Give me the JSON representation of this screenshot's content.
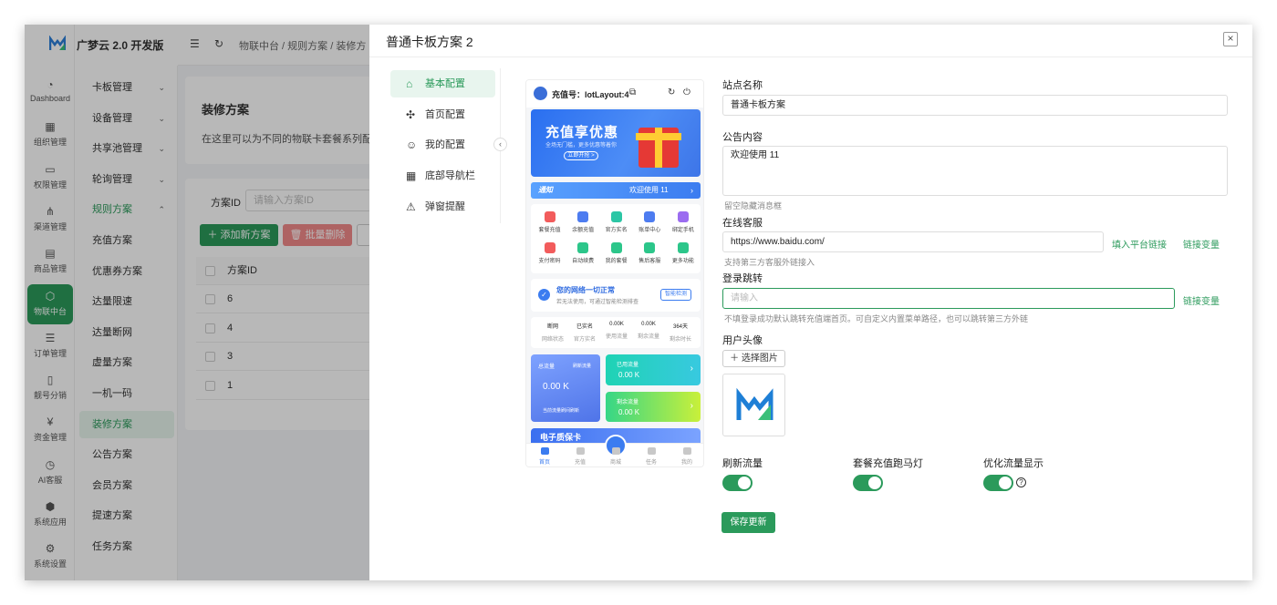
{
  "app": {
    "brand": "广梦云 2.0 开发版",
    "rail": [
      {
        "label": "Dashboard",
        "icon": "dashboard-icon"
      },
      {
        "label": "组织管理",
        "icon": "org-icon"
      },
      {
        "label": "权限管理",
        "icon": "permission-icon"
      },
      {
        "label": "渠道管理",
        "icon": "channel-icon"
      },
      {
        "label": "商品管理",
        "icon": "goods-icon"
      },
      {
        "label": "物联中台",
        "icon": "iot-icon",
        "active": true
      },
      {
        "label": "订单管理",
        "icon": "order-icon"
      },
      {
        "label": "靓号分销",
        "icon": "number-icon"
      },
      {
        "label": "资金管理",
        "icon": "fund-icon"
      },
      {
        "label": "AI客服",
        "icon": "ai-service-icon"
      },
      {
        "label": "系统应用",
        "icon": "system-app-icon"
      },
      {
        "label": "系统设置",
        "icon": "settings-icon"
      }
    ],
    "submenu": [
      {
        "label": "卡板管理",
        "chevron": "⌄"
      },
      {
        "label": "设备管理",
        "chevron": "⌄"
      },
      {
        "label": "共享池管理",
        "chevron": "⌄"
      },
      {
        "label": "轮询管理",
        "chevron": "⌄"
      },
      {
        "label": "规则方案",
        "chevron": "⌃",
        "open": true
      },
      {
        "label": "充值方案"
      },
      {
        "label": "优惠券方案"
      },
      {
        "label": "达量限速"
      },
      {
        "label": "达量断网"
      },
      {
        "label": "虚量方案"
      },
      {
        "label": "一机一码"
      },
      {
        "label": "装修方案",
        "active": true
      },
      {
        "label": "公告方案"
      },
      {
        "label": "会员方案"
      },
      {
        "label": "提速方案"
      },
      {
        "label": "任务方案"
      }
    ],
    "breadcrumb": "物联中台  /  规则方案  /  装修方",
    "page": {
      "title": "装修方案",
      "desc": "在这里可以为不同的物联卡套餐系列配置充",
      "filter_label": "方案ID",
      "filter_placeholder": "请输入方案ID",
      "add_btn": "＋ 添加新方案",
      "batch_delete_btn": "🗑 批量删除",
      "col_id": "方案ID",
      "rows": [
        "6",
        "4",
        "3",
        "1"
      ]
    }
  },
  "modal": {
    "title": "普通卡板方案 2",
    "tabs": [
      {
        "label": "基本配置",
        "icon": "home-icon",
        "glyph": "⌂",
        "active": true
      },
      {
        "label": "首页配置",
        "icon": "puzzle-icon",
        "glyph": "✣"
      },
      {
        "label": "我的配置",
        "icon": "user-icon",
        "glyph": "☺"
      },
      {
        "label": "底部导航栏",
        "icon": "grid-icon",
        "glyph": "▦"
      },
      {
        "label": "弹窗提醒",
        "icon": "alarm-icon",
        "glyph": "⚠"
      }
    ],
    "phone": {
      "header": "充值号：lotLayout:4",
      "banner_title": "充值享优惠",
      "banner_sub": "全场无门槛，更多优惠等着你",
      "banner_btn": "立即开抢 >",
      "notice_label": "通知",
      "notice_text": "欢迎使用 11",
      "services": [
        {
          "label": "套餐充值",
          "color": "#f25c5c"
        },
        {
          "label": "余额充值",
          "color": "#4d7cf0"
        },
        {
          "label": "官方实名",
          "color": "#2cc6a5"
        },
        {
          "label": "账单中心",
          "color": "#4d7cf0"
        },
        {
          "label": "绑定手机",
          "color": "#9b6cf0"
        },
        {
          "label": "支付密码",
          "color": "#f25c5c"
        },
        {
          "label": "自动续费",
          "color": "#2cc68a"
        },
        {
          "label": "我的套餐",
          "color": "#2cc68a"
        },
        {
          "label": "售后客服",
          "color": "#2cc68a"
        },
        {
          "label": "更多功能",
          "color": "#2cc68a"
        }
      ],
      "net_title": "您的网络一切正常",
      "net_sub": "若无法使用，可通过智能检测排查",
      "net_btn": "智能检测",
      "stats": [
        {
          "value": "断网",
          "label": "网络状态"
        },
        {
          "value": "已实名",
          "label": "官方实名"
        },
        {
          "value": "0.00K",
          "label": "使用流量"
        },
        {
          "value": "0.00K",
          "label": "剩余流量"
        },
        {
          "value": "364天",
          "label": "剩余时长"
        }
      ],
      "total_label": "总流量",
      "total_refresh": "刷新流量",
      "total_value": "0.00 K",
      "total_hint": "当前流量刷间刷新",
      "used_label": "已用流量",
      "used_value": "0.00 K",
      "left_label": "剩余流量",
      "left_value": "0.00 K",
      "ecard": "电子质保卡",
      "nav": [
        "首页",
        "充值",
        "商城",
        "任务",
        "我的"
      ]
    },
    "form": {
      "site_name_label": "站点名称",
      "site_name_value": "普通卡板方案",
      "notice_label": "公告内容",
      "notice_value": "欢迎使用 11",
      "notice_hint": "留空隐藏消息框",
      "service_label": "在线客服",
      "service_value": "https://www.baidu.com/",
      "service_link1": "填入平台链接",
      "service_link2": "链接变量",
      "service_hint": "支持第三方客服外链接入",
      "login_label": "登录跳转",
      "login_placeholder": "请输入",
      "login_link": "链接变量",
      "login_hint": "不填登录成功默认跳转充值端首页。可自定义内置菜单路径，也可以跳转第三方外链",
      "avatar_label": "用户头像",
      "avatar_btn": "＋ 选择图片",
      "switches": [
        {
          "label": "刷新流量",
          "on": true
        },
        {
          "label": "套餐充值跑马灯",
          "on": true
        },
        {
          "label": "优化流量显示",
          "on": true
        }
      ],
      "save_btn": "保存更新"
    }
  }
}
